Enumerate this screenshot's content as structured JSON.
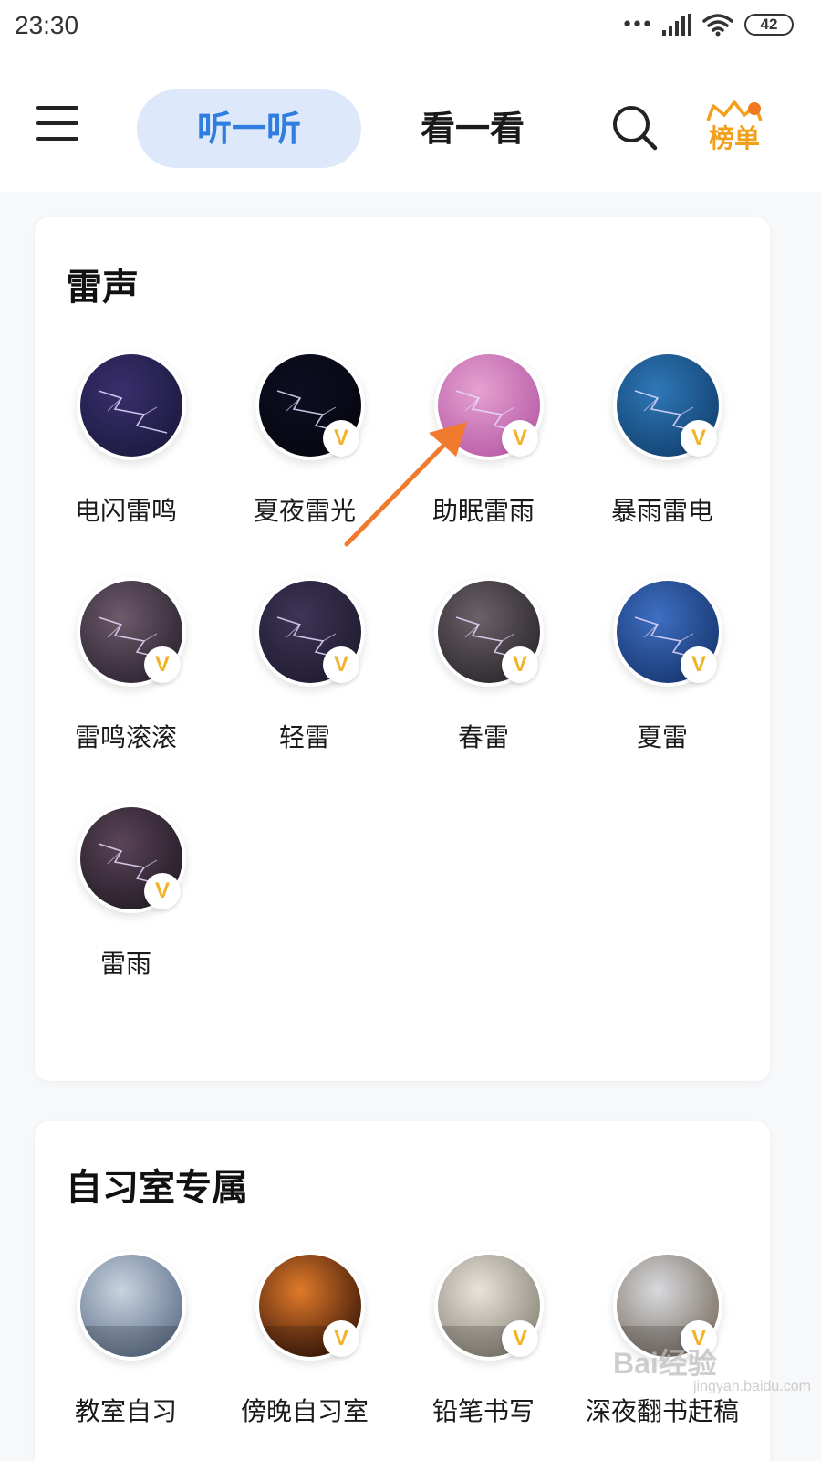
{
  "status_bar": {
    "time": "23:30",
    "battery": "42",
    "signal_dots": "•••"
  },
  "nav": {
    "tab_listen": "听一听",
    "tab_watch": "看一看",
    "rank_label": "榜单"
  },
  "sections": [
    {
      "title": "雷声",
      "items": [
        {
          "label": "电闪雷鸣",
          "vip": false,
          "colors": [
            "#3a2f6e",
            "#1a1a3e"
          ]
        },
        {
          "label": "夏夜雷光",
          "vip": true,
          "colors": [
            "#0d0f22",
            "#05060f"
          ]
        },
        {
          "label": "助眠雷雨",
          "vip": true,
          "colors": [
            "#e4a1d0",
            "#b85aa6"
          ]
        },
        {
          "label": "暴雨雷电",
          "vip": true,
          "colors": [
            "#2e78b8",
            "#12406e"
          ]
        },
        {
          "label": "雷鸣滚滚",
          "vip": true,
          "colors": [
            "#6e5a6a",
            "#2a2230"
          ]
        },
        {
          "label": "轻雷",
          "vip": true,
          "colors": [
            "#3e3556",
            "#1f1a30"
          ]
        },
        {
          "label": "春雷",
          "vip": true,
          "colors": [
            "#6a6268",
            "#2a262c"
          ]
        },
        {
          "label": "夏雷",
          "vip": true,
          "colors": [
            "#3e6fc2",
            "#16356e"
          ]
        },
        {
          "label": "雷雨",
          "vip": true,
          "colors": [
            "#5a4456",
            "#231b26"
          ]
        }
      ]
    },
    {
      "title": "自习室专属",
      "items": [
        {
          "label": "教室自习",
          "vip": false,
          "colors": [
            "#c9d4e0",
            "#5d6f8a"
          ]
        },
        {
          "label": "傍晚自习室",
          "vip": true,
          "colors": [
            "#e07a2a",
            "#3a1608"
          ]
        },
        {
          "label": "铅笔书写",
          "vip": true,
          "colors": [
            "#e8e4dc",
            "#8a8478"
          ]
        },
        {
          "label": "深夜翻书赶稿",
          "vip": true,
          "colors": [
            "#d8dade",
            "#7a6e62"
          ]
        }
      ]
    }
  ],
  "vip_badge": "V",
  "watermark": "Bai经验",
  "watermark_sub": "jingyan.baidu.com",
  "icons": [
    "menu-icon",
    "search-icon",
    "crown-icon",
    "wifi-icon",
    "signal-icon",
    "battery-icon",
    "lightning-icon"
  ]
}
